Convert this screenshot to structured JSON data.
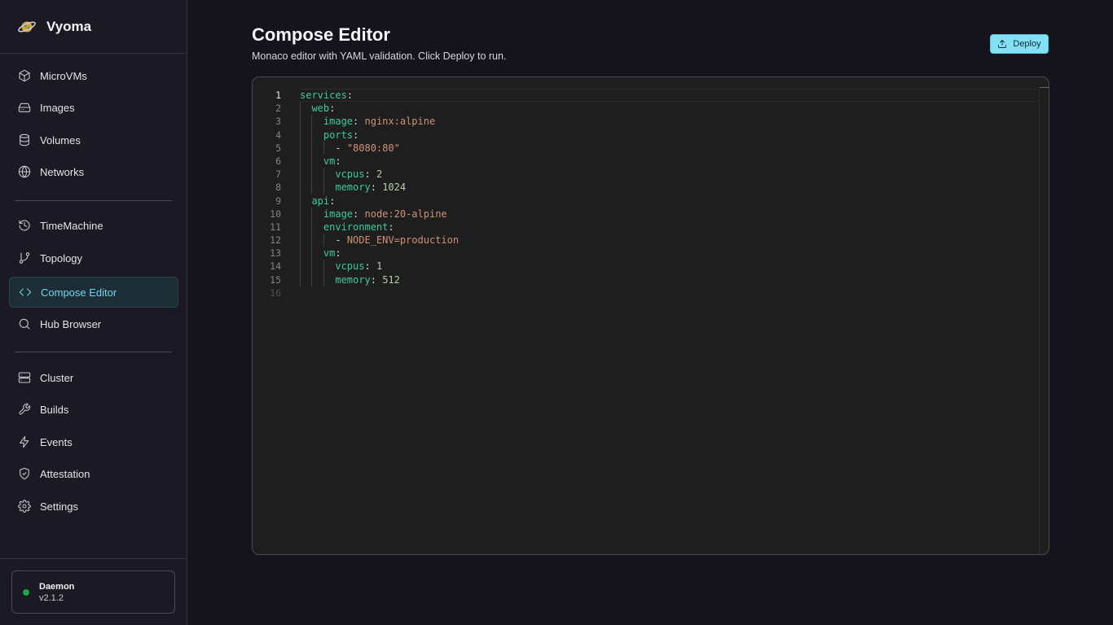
{
  "app": {
    "name": "Vyoma",
    "logo_icon": "planet-icon"
  },
  "sidebar": {
    "groups": [
      [
        {
          "label": "MicroVMs",
          "icon": "cube-icon"
        },
        {
          "label": "Images",
          "icon": "drive-icon"
        },
        {
          "label": "Volumes",
          "icon": "database-icon"
        },
        {
          "label": "Networks",
          "icon": "globe-icon"
        }
      ],
      [
        {
          "label": "TimeMachine",
          "icon": "history-icon"
        },
        {
          "label": "Topology",
          "icon": "git-branch-icon"
        },
        {
          "label": "Compose Editor",
          "icon": "code-icon",
          "active": true
        },
        {
          "label": "Hub Browser",
          "icon": "search-icon"
        }
      ],
      [
        {
          "label": "Cluster",
          "icon": "server-icon"
        },
        {
          "label": "Builds",
          "icon": "wrench-icon"
        },
        {
          "label": "Events",
          "icon": "lightning-icon"
        },
        {
          "label": "Attestation",
          "icon": "shield-check-icon"
        },
        {
          "label": "Settings",
          "icon": "gear-icon"
        }
      ]
    ],
    "daemon": {
      "name": "Daemon",
      "version": "v2.1.2",
      "status_color": "#1fa34a"
    }
  },
  "main": {
    "title": "Compose Editor",
    "subtitle": "Monaco editor with YAML validation. Click Deploy to run.",
    "deploy_label": "Deploy",
    "deploy_icon": "upload-icon"
  },
  "editor": {
    "language": "yaml",
    "current_line": 1,
    "lines": [
      "services:",
      "  web:",
      "    image: nginx:alpine",
      "    ports:",
      "      - \"8080:80\"",
      "    vm:",
      "      vcpus: 2",
      "      memory: 1024",
      "  api:",
      "    image: node:20-alpine",
      "    environment:",
      "      - NODE_ENV=production",
      "    vm:",
      "      vcpus: 1",
      "      memory: 512",
      ""
    ]
  },
  "colors": {
    "accent": "#6fd6f0",
    "deploy_button": "#83e1f6",
    "yaml_key": "#3dc9a0",
    "yaml_string": "#ce9178",
    "yaml_number": "#b5cea8"
  }
}
